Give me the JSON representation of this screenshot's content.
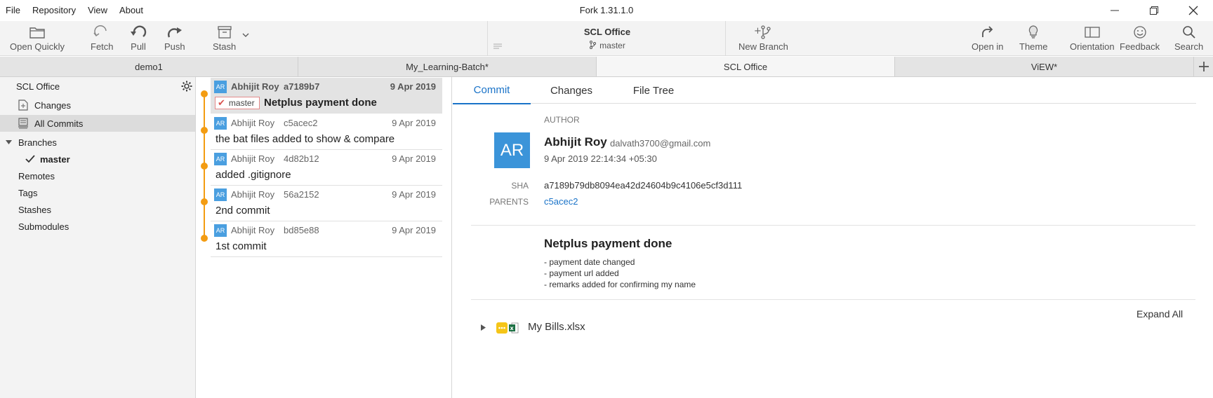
{
  "window": {
    "title": "Fork 1.31.1.0",
    "menu": [
      "File",
      "Repository",
      "View",
      "About"
    ]
  },
  "toolbar": {
    "open_quickly": "Open Quickly",
    "fetch": "Fetch",
    "pull": "Pull",
    "push": "Push",
    "stash": "Stash",
    "repo_name": "SCL Office",
    "repo_branch": "master",
    "new_branch": "New Branch",
    "open_in": "Open in",
    "theme": "Theme",
    "orientation": "Orientation",
    "feedback": "Feedback",
    "search": "Search"
  },
  "tabs": [
    {
      "label": "demo1"
    },
    {
      "label": "My_Learning-Batch*"
    },
    {
      "label": "SCL Office"
    },
    {
      "label": "ViEW*"
    }
  ],
  "sidebar": {
    "repo": "SCL Office",
    "changes": "Changes",
    "all_commits": "All Commits",
    "branches": "Branches",
    "current_branch": "master",
    "remotes": "Remotes",
    "tags": "Tags",
    "stashes": "Stashes",
    "submodules": "Submodules"
  },
  "commits": [
    {
      "initials": "AR",
      "author": "Abhijit Roy",
      "sha": "a7189b7",
      "date": "9 Apr 2019",
      "branch": "master",
      "message": "Netplus payment done"
    },
    {
      "initials": "AR",
      "author": "Abhijit Roy",
      "sha": "c5acec2",
      "date": "9 Apr 2019",
      "message": "the bat files added to show & compare"
    },
    {
      "initials": "AR",
      "author": "Abhijit Roy",
      "sha": "4d82b12",
      "date": "9 Apr 2019",
      "message": "added .gitignore"
    },
    {
      "initials": "AR",
      "author": "Abhijit Roy",
      "sha": "56a2152",
      "date": "9 Apr 2019",
      "message": "2nd commit"
    },
    {
      "initials": "AR",
      "author": "Abhijit Roy",
      "sha": "bd85e88",
      "date": "9 Apr 2019",
      "message": "1st commit"
    }
  ],
  "detail": {
    "tabs": [
      "Commit",
      "Changes",
      "File Tree"
    ],
    "author_label": "AUTHOR",
    "initials": "AR",
    "author_name": "Abhijit Roy",
    "author_email": "dalvath3700@gmail.com",
    "datetime": "9 Apr 2019 22:14:34 +05:30",
    "sha_label": "SHA",
    "sha": "a7189b79db8094ea42d24604b9c4106e5cf3d111",
    "parents_label": "PARENTS",
    "parent": "c5acec2",
    "subject": "Netplus payment done",
    "body": [
      "- payment date changed",
      "- payment url added",
      "- remarks added for confirming my name"
    ],
    "expand_all": "Expand All",
    "file": "My Bills.xlsx"
  },
  "colors": {
    "accent": "#1a73c8",
    "graph": "#f39c12",
    "avatar": "#4a9fe0"
  }
}
